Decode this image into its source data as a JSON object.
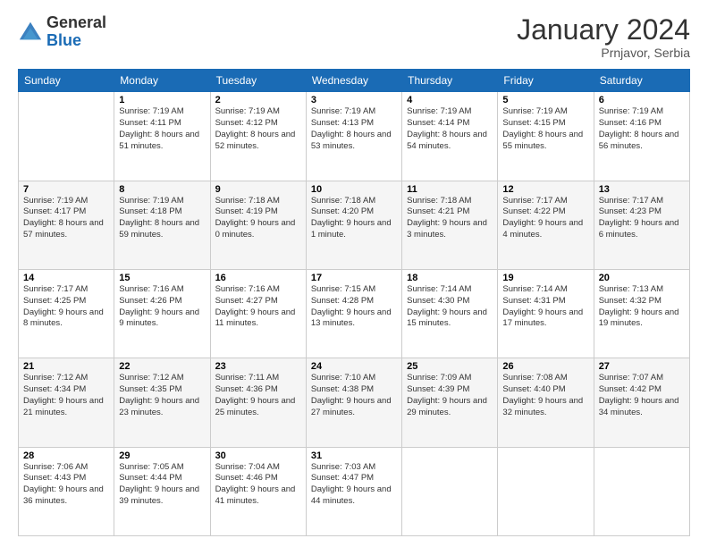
{
  "header": {
    "logo_general": "General",
    "logo_blue": "Blue",
    "month_title": "January 2024",
    "subtitle": "Prnjavor, Serbia"
  },
  "days_of_week": [
    "Sunday",
    "Monday",
    "Tuesday",
    "Wednesday",
    "Thursday",
    "Friday",
    "Saturday"
  ],
  "weeks": [
    [
      {
        "day": "",
        "sunrise": "",
        "sunset": "",
        "daylight": ""
      },
      {
        "day": "1",
        "sunrise": "Sunrise: 7:19 AM",
        "sunset": "Sunset: 4:11 PM",
        "daylight": "Daylight: 8 hours and 51 minutes."
      },
      {
        "day": "2",
        "sunrise": "Sunrise: 7:19 AM",
        "sunset": "Sunset: 4:12 PM",
        "daylight": "Daylight: 8 hours and 52 minutes."
      },
      {
        "day": "3",
        "sunrise": "Sunrise: 7:19 AM",
        "sunset": "Sunset: 4:13 PM",
        "daylight": "Daylight: 8 hours and 53 minutes."
      },
      {
        "day": "4",
        "sunrise": "Sunrise: 7:19 AM",
        "sunset": "Sunset: 4:14 PM",
        "daylight": "Daylight: 8 hours and 54 minutes."
      },
      {
        "day": "5",
        "sunrise": "Sunrise: 7:19 AM",
        "sunset": "Sunset: 4:15 PM",
        "daylight": "Daylight: 8 hours and 55 minutes."
      },
      {
        "day": "6",
        "sunrise": "Sunrise: 7:19 AM",
        "sunset": "Sunset: 4:16 PM",
        "daylight": "Daylight: 8 hours and 56 minutes."
      }
    ],
    [
      {
        "day": "7",
        "sunrise": "Sunrise: 7:19 AM",
        "sunset": "Sunset: 4:17 PM",
        "daylight": "Daylight: 8 hours and 57 minutes."
      },
      {
        "day": "8",
        "sunrise": "Sunrise: 7:19 AM",
        "sunset": "Sunset: 4:18 PM",
        "daylight": "Daylight: 8 hours and 59 minutes."
      },
      {
        "day": "9",
        "sunrise": "Sunrise: 7:18 AM",
        "sunset": "Sunset: 4:19 PM",
        "daylight": "Daylight: 9 hours and 0 minutes."
      },
      {
        "day": "10",
        "sunrise": "Sunrise: 7:18 AM",
        "sunset": "Sunset: 4:20 PM",
        "daylight": "Daylight: 9 hours and 1 minute."
      },
      {
        "day": "11",
        "sunrise": "Sunrise: 7:18 AM",
        "sunset": "Sunset: 4:21 PM",
        "daylight": "Daylight: 9 hours and 3 minutes."
      },
      {
        "day": "12",
        "sunrise": "Sunrise: 7:17 AM",
        "sunset": "Sunset: 4:22 PM",
        "daylight": "Daylight: 9 hours and 4 minutes."
      },
      {
        "day": "13",
        "sunrise": "Sunrise: 7:17 AM",
        "sunset": "Sunset: 4:23 PM",
        "daylight": "Daylight: 9 hours and 6 minutes."
      }
    ],
    [
      {
        "day": "14",
        "sunrise": "Sunrise: 7:17 AM",
        "sunset": "Sunset: 4:25 PM",
        "daylight": "Daylight: 9 hours and 8 minutes."
      },
      {
        "day": "15",
        "sunrise": "Sunrise: 7:16 AM",
        "sunset": "Sunset: 4:26 PM",
        "daylight": "Daylight: 9 hours and 9 minutes."
      },
      {
        "day": "16",
        "sunrise": "Sunrise: 7:16 AM",
        "sunset": "Sunset: 4:27 PM",
        "daylight": "Daylight: 9 hours and 11 minutes."
      },
      {
        "day": "17",
        "sunrise": "Sunrise: 7:15 AM",
        "sunset": "Sunset: 4:28 PM",
        "daylight": "Daylight: 9 hours and 13 minutes."
      },
      {
        "day": "18",
        "sunrise": "Sunrise: 7:14 AM",
        "sunset": "Sunset: 4:30 PM",
        "daylight": "Daylight: 9 hours and 15 minutes."
      },
      {
        "day": "19",
        "sunrise": "Sunrise: 7:14 AM",
        "sunset": "Sunset: 4:31 PM",
        "daylight": "Daylight: 9 hours and 17 minutes."
      },
      {
        "day": "20",
        "sunrise": "Sunrise: 7:13 AM",
        "sunset": "Sunset: 4:32 PM",
        "daylight": "Daylight: 9 hours and 19 minutes."
      }
    ],
    [
      {
        "day": "21",
        "sunrise": "Sunrise: 7:12 AM",
        "sunset": "Sunset: 4:34 PM",
        "daylight": "Daylight: 9 hours and 21 minutes."
      },
      {
        "day": "22",
        "sunrise": "Sunrise: 7:12 AM",
        "sunset": "Sunset: 4:35 PM",
        "daylight": "Daylight: 9 hours and 23 minutes."
      },
      {
        "day": "23",
        "sunrise": "Sunrise: 7:11 AM",
        "sunset": "Sunset: 4:36 PM",
        "daylight": "Daylight: 9 hours and 25 minutes."
      },
      {
        "day": "24",
        "sunrise": "Sunrise: 7:10 AM",
        "sunset": "Sunset: 4:38 PM",
        "daylight": "Daylight: 9 hours and 27 minutes."
      },
      {
        "day": "25",
        "sunrise": "Sunrise: 7:09 AM",
        "sunset": "Sunset: 4:39 PM",
        "daylight": "Daylight: 9 hours and 29 minutes."
      },
      {
        "day": "26",
        "sunrise": "Sunrise: 7:08 AM",
        "sunset": "Sunset: 4:40 PM",
        "daylight": "Daylight: 9 hours and 32 minutes."
      },
      {
        "day": "27",
        "sunrise": "Sunrise: 7:07 AM",
        "sunset": "Sunset: 4:42 PM",
        "daylight": "Daylight: 9 hours and 34 minutes."
      }
    ],
    [
      {
        "day": "28",
        "sunrise": "Sunrise: 7:06 AM",
        "sunset": "Sunset: 4:43 PM",
        "daylight": "Daylight: 9 hours and 36 minutes."
      },
      {
        "day": "29",
        "sunrise": "Sunrise: 7:05 AM",
        "sunset": "Sunset: 4:44 PM",
        "daylight": "Daylight: 9 hours and 39 minutes."
      },
      {
        "day": "30",
        "sunrise": "Sunrise: 7:04 AM",
        "sunset": "Sunset: 4:46 PM",
        "daylight": "Daylight: 9 hours and 41 minutes."
      },
      {
        "day": "31",
        "sunrise": "Sunrise: 7:03 AM",
        "sunset": "Sunset: 4:47 PM",
        "daylight": "Daylight: 9 hours and 44 minutes."
      },
      {
        "day": "",
        "sunrise": "",
        "sunset": "",
        "daylight": ""
      },
      {
        "day": "",
        "sunrise": "",
        "sunset": "",
        "daylight": ""
      },
      {
        "day": "",
        "sunrise": "",
        "sunset": "",
        "daylight": ""
      }
    ]
  ]
}
